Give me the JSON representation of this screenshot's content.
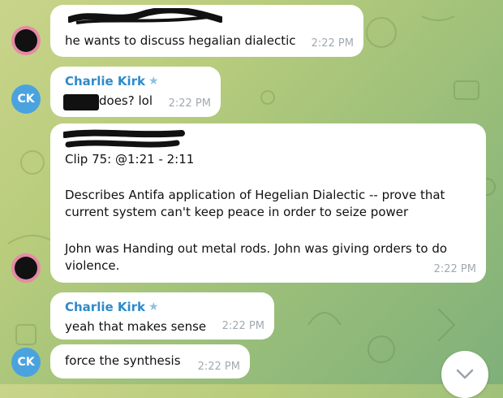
{
  "messages": [
    {
      "text": "he wants to discuss hegalian dialectic",
      "time": "2:22 PM"
    },
    {
      "sender": "Charlie Kirk",
      "text": "does? lol",
      "time": "2:22 PM"
    },
    {
      "line1": "Clip 75: @1:21 - 2:11",
      "line2": "Describes Antifa application of Hegelian Dialectic -- prove that current system can't keep peace in order to seize power",
      "line3": "John was Handing out metal rods. John was giving orders to do violence.",
      "time": "2:22 PM"
    },
    {
      "sender": "Charlie Kirk",
      "text": "yeah that makes sense",
      "time": "2:22 PM"
    },
    {
      "text": "force the synthesis",
      "time": "2:22 PM"
    }
  ],
  "avatars": {
    "ck_initials": "CK"
  },
  "icons": {
    "verified": "star-icon",
    "scroll_down": "chevron-down-icon"
  }
}
